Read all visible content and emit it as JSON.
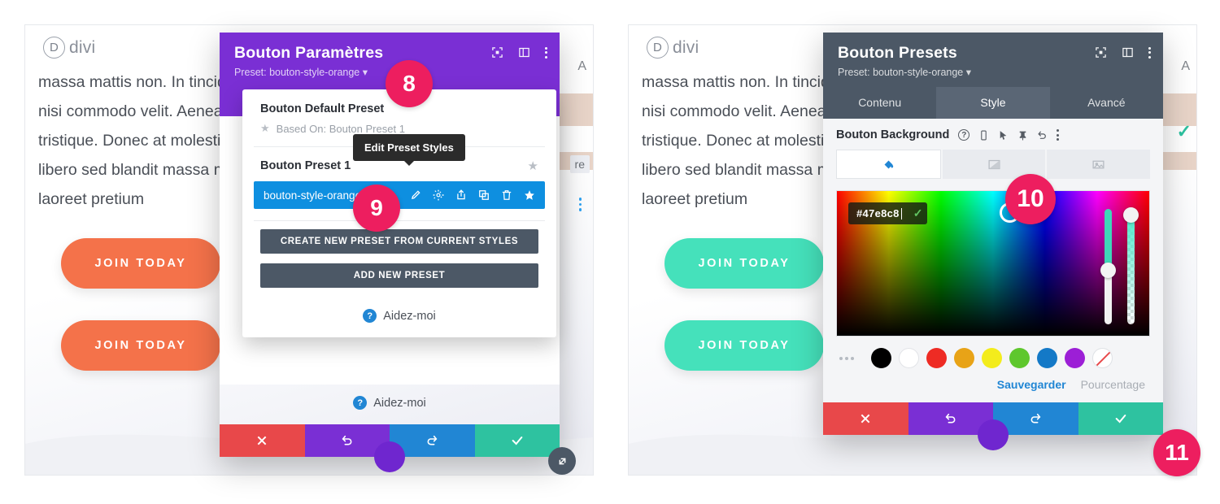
{
  "colors": {
    "purple": "#7a2fd4",
    "slate": "#4c5866",
    "blue": "#0e8fe0",
    "teal": "#2ec2a0",
    "red": "#e8484a",
    "badge_pink": "#ed1e5f",
    "cta_orange": "#f4724a",
    "cta_teal": "#45e1bb"
  },
  "page": {
    "logo_mark": "D",
    "logo_text": "divi",
    "paragraph_lines": [
      "massa mattis non. In tincidunt",
      "nisi commodo velit. Aenean fin",
      "tristique. Donec at molestie te",
      "libero sed blandit massa matti",
      "laoreet pretium"
    ],
    "cta_label": "JOIN TODAY",
    "edge_letter": "A",
    "edge_tab_label": "re"
  },
  "left_modal": {
    "title": "Bouton Paramètres",
    "subtitle": "Preset: bouton-style-orange ▾",
    "header_icons": [
      "fullscreen-icon",
      "layout-icon",
      "kebab-icon"
    ],
    "preset_dropdown": {
      "default_preset_name": "Bouton Default Preset",
      "based_on_label": "Based On: Bouton Preset 1",
      "preset_1_name": "Bouton Preset 1",
      "active_preset_name": "bouton-style-orange",
      "active_preset_icons": [
        "pencil-icon",
        "gear-icon",
        "export-icon",
        "duplicate-icon",
        "trash-icon",
        "star-icon"
      ],
      "tooltip": "Edit Preset Styles",
      "create_button": "CREATE NEW PRESET FROM CURRENT STYLES",
      "add_button": "ADD NEW PRESET",
      "help_label": "Aidez-moi"
    },
    "help_label": "Aidez-moi",
    "action_bar": [
      "close-icon",
      "undo-icon",
      "redo-icon",
      "save-icon"
    ]
  },
  "right_modal": {
    "title": "Bouton Presets",
    "subtitle": "Preset: bouton-style-orange ▾",
    "header_icons": [
      "fullscreen-icon",
      "layout-icon",
      "kebab-icon"
    ],
    "tabs": [
      {
        "label": "Contenu",
        "active": false
      },
      {
        "label": "Style",
        "active": true
      },
      {
        "label": "Avancé",
        "active": false
      }
    ],
    "field": {
      "label": "Bouton Background",
      "tool_icons": [
        "help-icon",
        "responsive-icon",
        "hover-icon",
        "pin-icon",
        "reset-icon",
        "kebab-icon"
      ],
      "bg_types": [
        "color-fill-icon",
        "gradient-icon",
        "image-icon"
      ],
      "active_bg_type": 0
    },
    "color_picker": {
      "hex_value": "#47e8c8",
      "confirm_icon": "check-icon",
      "swatches": [
        "#000000",
        "#ffffff",
        "#ee2b24",
        "#e8a317",
        "#f3ec1c",
        "#5ec72d",
        "#1479c7",
        "#9c1fd6"
      ],
      "swatch_none": "transparent-swatch",
      "more_icon": "ellipsis-icon"
    },
    "sub_links": [
      {
        "label": "Sauvegarder",
        "active": true
      },
      {
        "label": "Pourcentage",
        "active": false
      }
    ],
    "action_bar": [
      "close-icon",
      "undo-icon",
      "redo-icon",
      "save-icon"
    ]
  },
  "callouts": [
    {
      "number": "8"
    },
    {
      "number": "9"
    },
    {
      "number": "10"
    },
    {
      "number": "11"
    }
  ]
}
